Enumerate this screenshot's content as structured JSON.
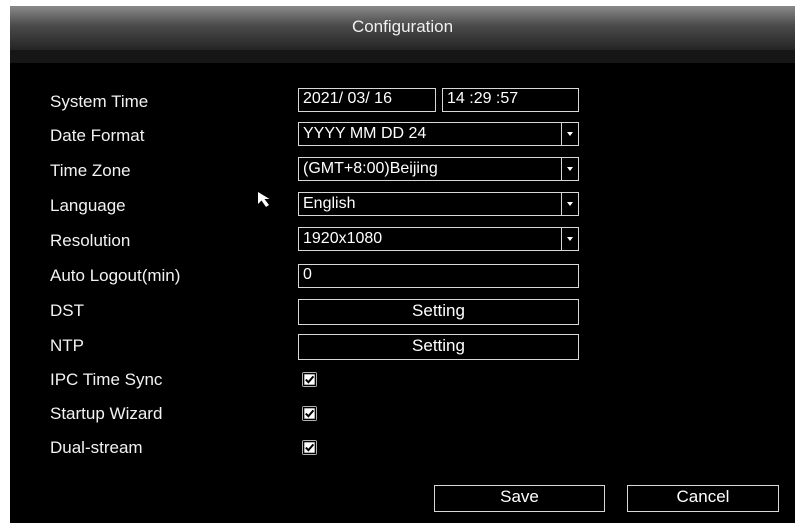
{
  "dialog": {
    "title": "Configuration"
  },
  "labels": {
    "system_time": "System Time",
    "date_format": "Date Format",
    "time_zone": "Time Zone",
    "language": "Language",
    "resolution": "Resolution",
    "auto_logout": "Auto Logout(min)",
    "dst": "DST",
    "ntp": "NTP",
    "ipc_time_sync": "IPC Time Sync",
    "startup_wizard": "Startup Wizard",
    "dual_stream": "Dual-stream"
  },
  "values": {
    "date": "2021/ 03/ 16",
    "time": "14 :29 :57",
    "date_format": "YYYY MM DD 24",
    "time_zone": "(GMT+8:00)Beijing",
    "language": "English",
    "resolution": "1920x1080",
    "auto_logout": "0"
  },
  "checkboxes": {
    "ipc_time_sync": true,
    "startup_wizard": true,
    "dual_stream": true
  },
  "buttons": {
    "dst_setting": "Setting",
    "ntp_setting": "Setting",
    "save": "Save",
    "cancel": "Cancel"
  },
  "icons": {
    "dropdown": "chevron-down-icon",
    "checkbox": "check-icon",
    "cursor": "mouse-pointer-icon"
  },
  "colors": {
    "background": "#000000",
    "text": "#f2f2f2",
    "border": "#d8d8d8",
    "title_bar": "#4a4a4a"
  }
}
